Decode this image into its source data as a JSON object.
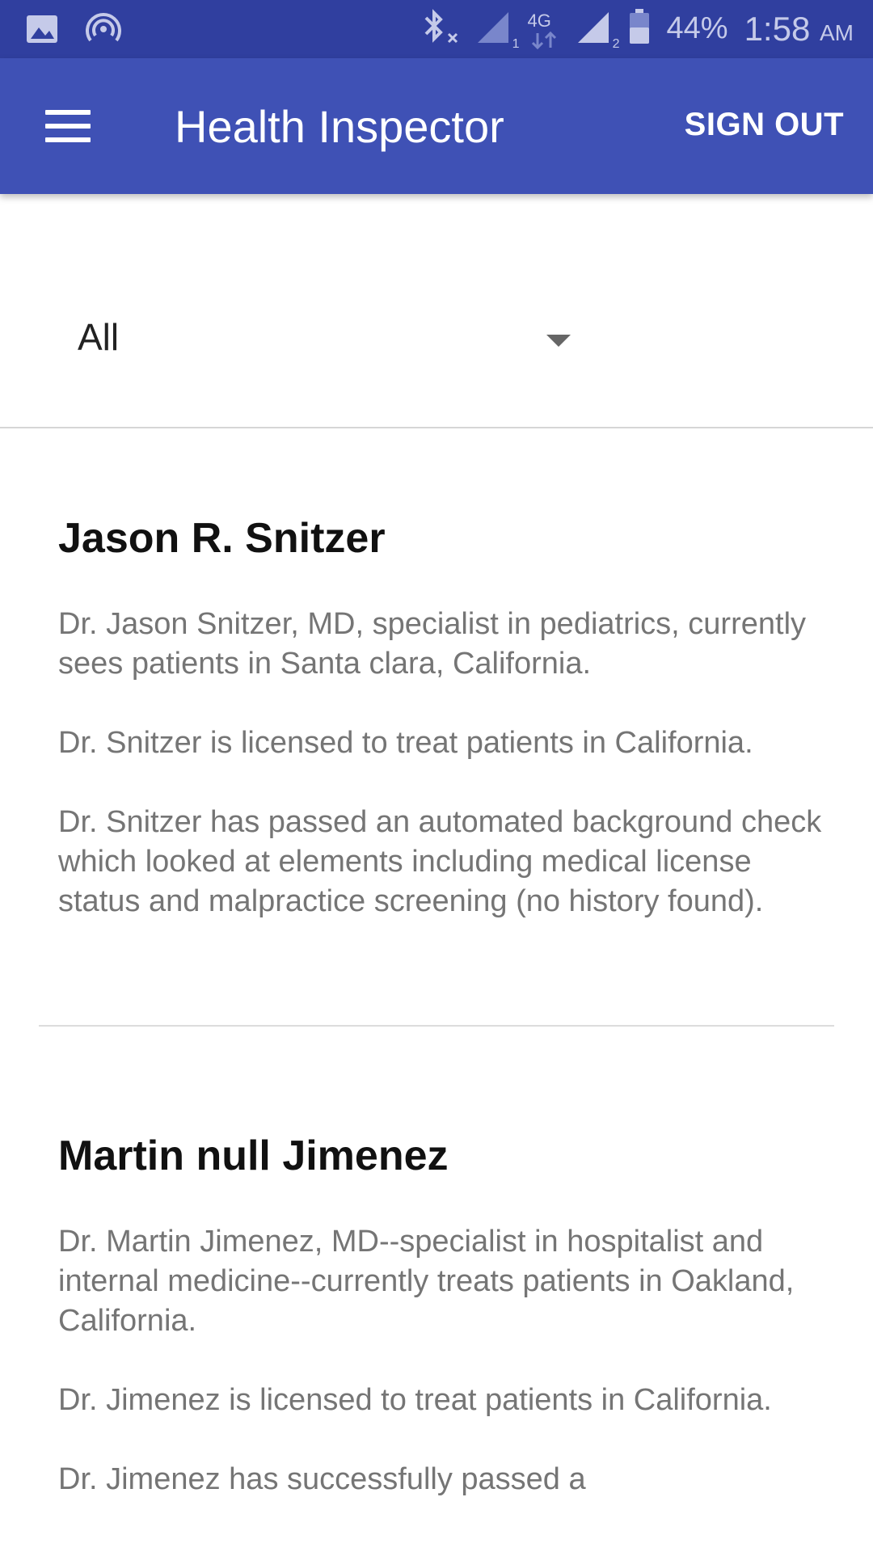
{
  "status_bar": {
    "battery": "44%",
    "time": "1:58",
    "ampm": "AM",
    "network": "4G",
    "sim1": "1",
    "sim2": "2",
    "icons": [
      "image-icon",
      "hotspot-icon",
      "bluetooth-icon",
      "signal-icon",
      "battery-icon"
    ]
  },
  "app_bar": {
    "title": "Health Inspector",
    "sign_out_label": "SIGN OUT",
    "background": "#3f51b5"
  },
  "filter": {
    "selected": "All"
  },
  "doctors": [
    {
      "name": "Jason R. Snitzer",
      "paragraphs": [
        "Dr. Jason Snitzer, MD, specialist in pediatrics, currently sees patients in Santa clara, California.",
        "Dr. Snitzer is licensed to treat patients in California.",
        "Dr. Snitzer has passed an automated background check which looked at elements including medical license status and malpractice screening (no history found)."
      ]
    },
    {
      "name": "Martin null Jimenez",
      "paragraphs": [
        "Dr. Martin Jimenez, MD--specialist in hospitalist and internal medicine--currently treats patients in Oakland, California.",
        "Dr. Jimenez is licensed to treat patients in California.",
        "Dr. Jimenez has successfully passed a"
      ]
    }
  ]
}
